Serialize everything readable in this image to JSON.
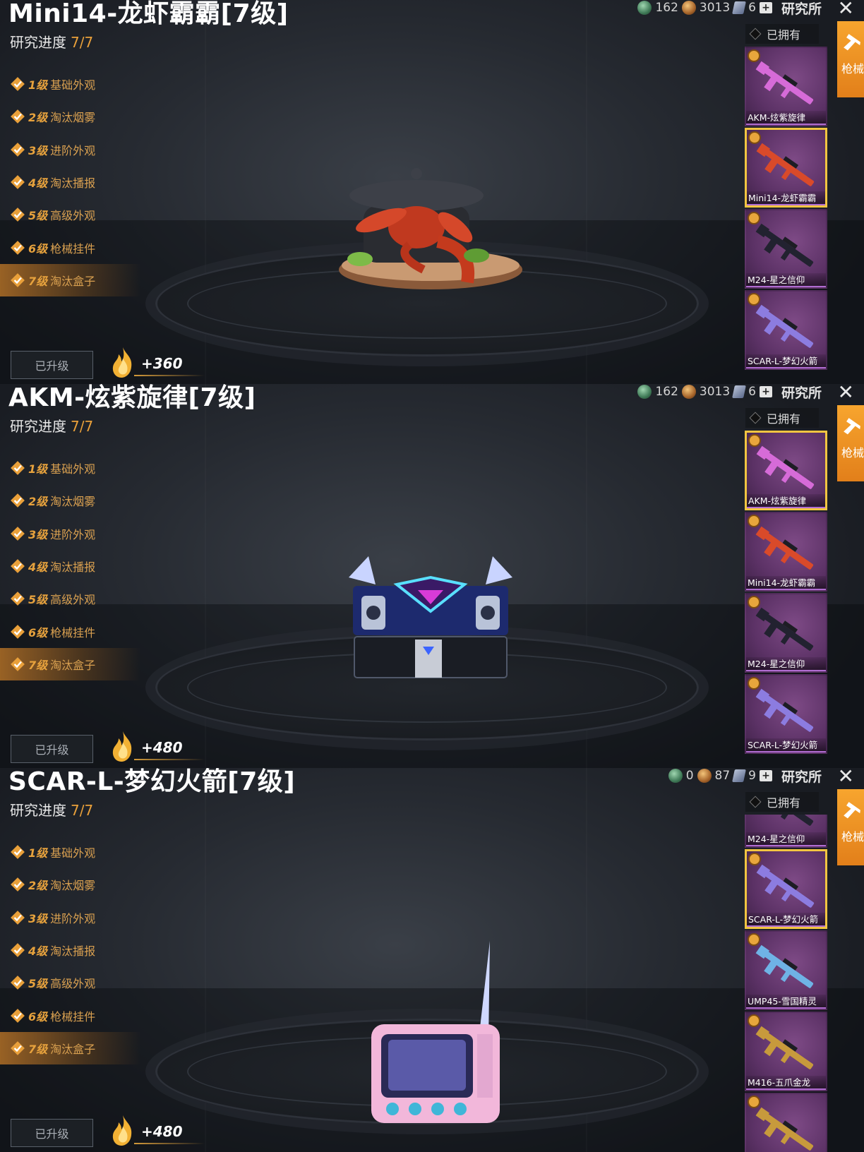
{
  "panels": [
    {
      "title": "Mini14-龙虾霸霸[7级]",
      "progress_label": "研究进度",
      "progress_value": "7/7",
      "levels": [
        {
          "lv": "1级",
          "name": "基础外观"
        },
        {
          "lv": "2级",
          "name": "淘汰烟雾"
        },
        {
          "lv": "3级",
          "name": "进阶外观"
        },
        {
          "lv": "4级",
          "name": "淘汰播报"
        },
        {
          "lv": "5级",
          "name": "高级外观"
        },
        {
          "lv": "6级",
          "name": "枪械挂件"
        },
        {
          "lv": "7级",
          "name": "淘汰盒子"
        }
      ],
      "upgrade_label": "已升级",
      "fire_value": "+360",
      "currency": {
        "green": "162",
        "bronze": "3013",
        "cards": "6",
        "lab_label": "研究所"
      },
      "owned_label": "已拥有",
      "side_tab_label": "枪械",
      "weapons": [
        "AKM-炫紫旋律",
        "Mini14-龙虾霸霸",
        "M24-星之信仰",
        "SCAR-L-梦幻火箭"
      ],
      "selected_weapon": 1
    },
    {
      "title": "AKM-炫紫旋律[7级]",
      "progress_label": "研究进度",
      "progress_value": "7/7",
      "levels": [
        {
          "lv": "1级",
          "name": "基础外观"
        },
        {
          "lv": "2级",
          "name": "淘汰烟雾"
        },
        {
          "lv": "3级",
          "name": "进阶外观"
        },
        {
          "lv": "4级",
          "name": "淘汰播报"
        },
        {
          "lv": "5级",
          "name": "高级外观"
        },
        {
          "lv": "6级",
          "name": "枪械挂件"
        },
        {
          "lv": "7级",
          "name": "淘汰盒子"
        }
      ],
      "upgrade_label": "已升级",
      "fire_value": "+480",
      "currency": {
        "green": "162",
        "bronze": "3013",
        "cards": "6",
        "lab_label": "研究所"
      },
      "owned_label": "已拥有",
      "side_tab_label": "枪械",
      "weapons": [
        "AKM-炫紫旋律",
        "Mini14-龙虾霸霸",
        "M24-星之信仰",
        "SCAR-L-梦幻火箭"
      ],
      "selected_weapon": 0
    },
    {
      "title": "SCAR-L-梦幻火箭[7级]",
      "progress_label": "研究进度",
      "progress_value": "7/7",
      "levels": [
        {
          "lv": "1级",
          "name": "基础外观"
        },
        {
          "lv": "2级",
          "name": "淘汰烟雾"
        },
        {
          "lv": "3级",
          "name": "进阶外观"
        },
        {
          "lv": "4级",
          "name": "淘汰播报"
        },
        {
          "lv": "5级",
          "name": "高级外观"
        },
        {
          "lv": "6级",
          "name": "枪械挂件"
        },
        {
          "lv": "7级",
          "name": "淘汰盒子"
        }
      ],
      "upgrade_label": "已升级",
      "fire_value": "+480",
      "currency": {
        "green": "0",
        "bronze": "87",
        "cards": "9",
        "lab_label": "研究所"
      },
      "owned_label": "已拥有",
      "side_tab_label": "枪械",
      "weapons": [
        "M24-星之信仰",
        "SCAR-L-梦幻火箭",
        "UMP45-雪国精灵",
        "M416-五爪金龙",
        ""
      ],
      "selected_weapon": 1
    }
  ],
  "colors": {
    "accent": "#e9a03a",
    "selected_border": "#f2c541",
    "side_tab": "#f39a27",
    "card_purple": "#5c3266"
  }
}
